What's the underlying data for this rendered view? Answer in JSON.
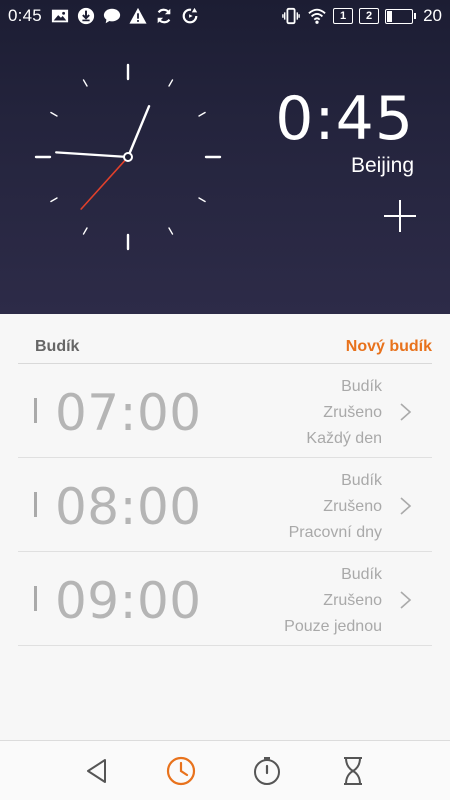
{
  "status_bar": {
    "time": "0:45",
    "sim1": "1",
    "sim2": "2",
    "battery_percent": "20",
    "battery_level": 0.2,
    "left_icons": [
      "image-icon",
      "download-icon",
      "chat-icon",
      "warning-icon",
      "sync-icon",
      "sync-alt-icon"
    ],
    "right_icons": [
      "vibrate-icon",
      "wifi-icon"
    ]
  },
  "world_clock": {
    "time": "0:45",
    "city": "Beijing",
    "add_icon": "plus-icon",
    "analog": {
      "hour": 0,
      "minute": 45,
      "second": 37
    }
  },
  "alarms": {
    "title": "Budík",
    "new_alarm_label": "Nový budík",
    "items": [
      {
        "time": "07:00",
        "label": "Budík",
        "status": "Zrušeno",
        "repeat": "Každý den",
        "enabled": false
      },
      {
        "time": "08:00",
        "label": "Budík",
        "status": "Zrušeno",
        "repeat": "Pracovní dny",
        "enabled": false
      },
      {
        "time": "09:00",
        "label": "Budík",
        "status": "Zrušeno",
        "repeat": "Pouze jednou",
        "enabled": false
      }
    ]
  },
  "bottom_nav": {
    "items": [
      "back-icon",
      "alarm-clock-icon",
      "stopwatch-icon",
      "timer-icon"
    ],
    "active_index": 1
  },
  "colors": {
    "accent": "#e8721c",
    "header_dark": "#1c1d33",
    "second_hand": "#e0402b"
  }
}
